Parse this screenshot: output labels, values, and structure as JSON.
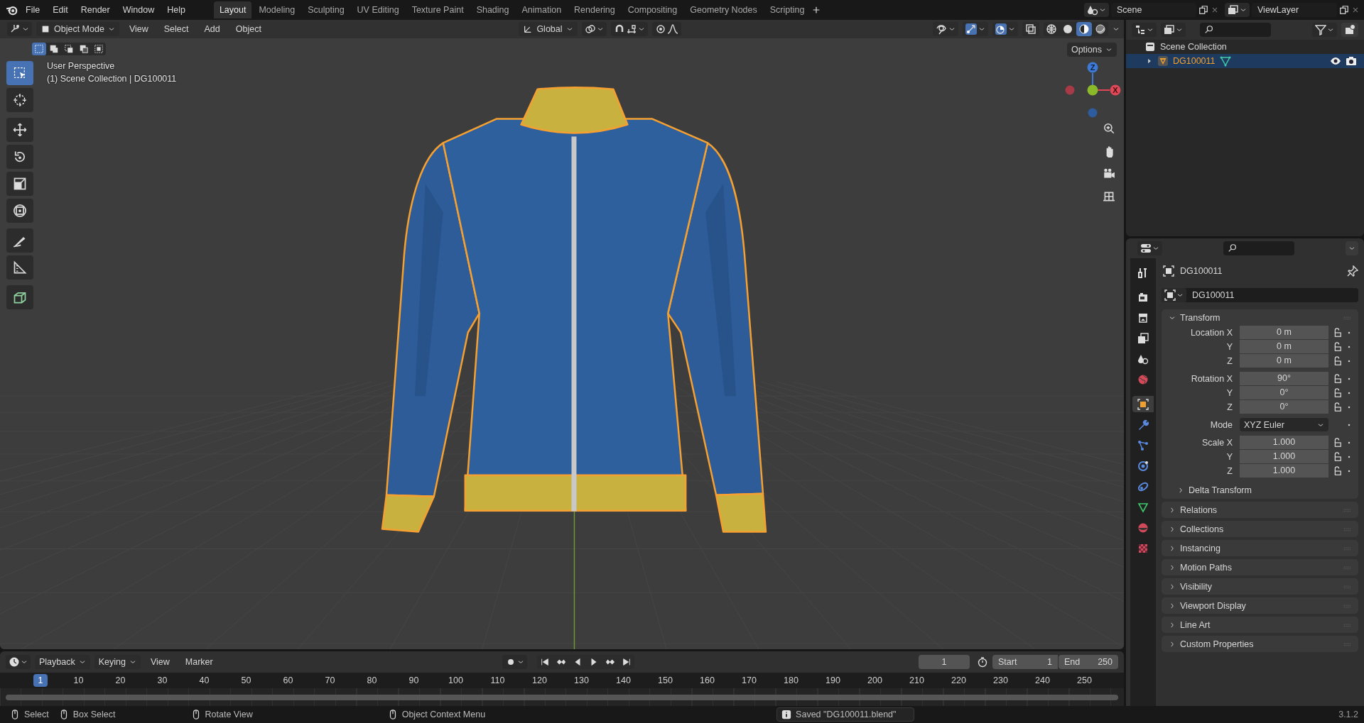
{
  "menu": [
    "File",
    "Edit",
    "Render",
    "Window",
    "Help"
  ],
  "workspaces": [
    {
      "label": "Layout",
      "selected": true
    },
    {
      "label": "Modeling",
      "selected": false
    },
    {
      "label": "Sculpting",
      "selected": false
    },
    {
      "label": "UV Editing",
      "selected": false
    },
    {
      "label": "Texture Paint",
      "selected": false
    },
    {
      "label": "Shading",
      "selected": false
    },
    {
      "label": "Animation",
      "selected": false
    },
    {
      "label": "Rendering",
      "selected": false
    },
    {
      "label": "Compositing",
      "selected": false
    },
    {
      "label": "Geometry Nodes",
      "selected": false
    },
    {
      "label": "Scripting",
      "selected": false
    }
  ],
  "scene": "Scene",
  "view_layer": "ViewLayer",
  "viewport": {
    "mode": "Object Mode",
    "menus": [
      "View",
      "Select",
      "Add",
      "Object"
    ],
    "orientation": "Global",
    "options": "Options",
    "select_modes": [
      {
        "selected": true
      },
      {
        "selected": false
      },
      {
        "selected": false
      },
      {
        "selected": false
      },
      {
        "selected": false
      }
    ],
    "toggles": [
      {
        "on": false
      },
      {
        "on": true
      },
      {
        "on": true
      },
      {
        "on": false
      }
    ],
    "shading": [
      {
        "selected": false
      },
      {
        "selected": false
      },
      {
        "selected": true
      },
      {
        "selected": false
      }
    ],
    "info": [
      "User Perspective",
      "(1) Scene Collection | DG100011"
    ],
    "tools": [
      {
        "selected": true
      },
      {
        "selected": false
      },
      {
        "selected": false
      },
      {
        "selected": false
      },
      {
        "selected": false
      },
      {
        "selected": false
      },
      {
        "selected": false
      },
      {
        "selected": false
      },
      {
        "selected": false
      }
    ],
    "gizmo_labels": [
      "Z",
      "X"
    ]
  },
  "outliner": {
    "root": "Scene Collection",
    "items": [
      {
        "name": "DG100011",
        "selected": true,
        "expanded": false
      }
    ]
  },
  "properties": {
    "tabs": [
      {
        "selected": false
      },
      {
        "selected": false
      },
      {
        "selected": false
      },
      {
        "selected": false
      },
      {
        "selected": false
      },
      {
        "selected": false
      },
      {
        "selected": true
      },
      {
        "selected": false
      },
      {
        "selected": false
      },
      {
        "selected": false
      },
      {
        "selected": false
      },
      {
        "selected": false
      },
      {
        "selected": false
      },
      {
        "selected": false
      }
    ],
    "object_name": "DG100011",
    "data_name": "DG100011",
    "transform": {
      "label": "Transform",
      "expanded": true,
      "groups": [
        {
          "kind": "vector",
          "rows": [
            {
              "label": "Location X",
              "value": "0 m"
            },
            {
              "label": "Y",
              "value": "0 m"
            },
            {
              "label": "Z",
              "value": "0 m"
            }
          ]
        },
        {
          "kind": "vector",
          "rows": [
            {
              "label": "Rotation X",
              "value": "90°"
            },
            {
              "label": "Y",
              "value": "0°"
            },
            {
              "label": "Z",
              "value": "0°"
            }
          ]
        },
        {
          "kind": "dropdown",
          "rows": [
            {
              "label": "Mode",
              "value": "XYZ Euler"
            }
          ]
        },
        {
          "kind": "vector",
          "rows": [
            {
              "label": "Scale X",
              "value": "1.000"
            },
            {
              "label": "Y",
              "value": "1.000"
            },
            {
              "label": "Z",
              "value": "1.000"
            }
          ]
        }
      ],
      "subpanel": {
        "label": "Delta Transform",
        "expanded": false
      }
    },
    "panels": [
      {
        "label": "Relations",
        "expanded": false
      },
      {
        "label": "Collections",
        "expanded": false
      },
      {
        "label": "Instancing",
        "expanded": false
      },
      {
        "label": "Motion Paths",
        "expanded": false
      },
      {
        "label": "Visibility",
        "expanded": false
      },
      {
        "label": "Viewport Display",
        "expanded": false
      },
      {
        "label": "Line Art",
        "expanded": false
      },
      {
        "label": "Custom Properties",
        "expanded": false
      }
    ]
  },
  "timeline": {
    "menus": [
      {
        "label": "Playback",
        "kind": "dropdown"
      },
      {
        "label": "Keying",
        "kind": "dropdown"
      },
      {
        "label": "View",
        "kind": "plain"
      },
      {
        "label": "Marker",
        "kind": "plain"
      }
    ],
    "current_frame": "1",
    "start_label": "Start",
    "start": "1",
    "end_label": "End",
    "end": "250",
    "playhead": "1",
    "ruler": [
      "10",
      "20",
      "30",
      "40",
      "50",
      "60",
      "70",
      "80",
      "90",
      "100",
      "110",
      "120",
      "130",
      "140",
      "150",
      "160",
      "170",
      "180",
      "190",
      "200",
      "210",
      "220",
      "230",
      "240",
      "250"
    ]
  },
  "status_bar": {
    "hints": [
      "Select",
      "Box Select",
      "Rotate View",
      "Object Context Menu"
    ],
    "message": "Saved \"DG100011.blend\"",
    "version": "3.1.2"
  }
}
